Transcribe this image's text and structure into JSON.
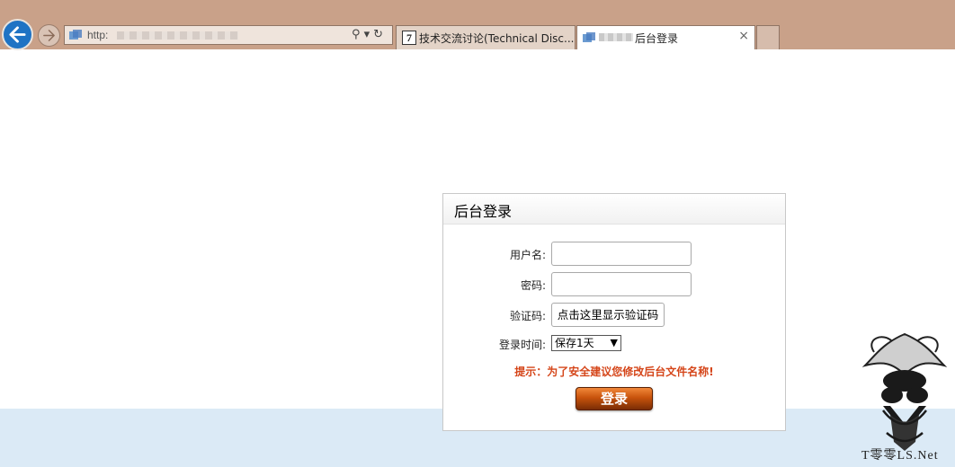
{
  "browser": {
    "address_text": "http:",
    "tabs": [
      {
        "label": "技术交流讨论(Technical Disc...",
        "active": false
      },
      {
        "label": "后台登录",
        "active": true
      }
    ],
    "close_glyph": "×"
  },
  "login": {
    "title": "后台登录",
    "username_label": "用户名:",
    "password_label": "密码:",
    "captcha_label": "验证码:",
    "captcha_button": "点击这里显示验证码",
    "time_label": "登录时间:",
    "time_selected": "保存1天",
    "hint": "提示：为了安全建议您修改后台文件名称!",
    "submit": "登录"
  },
  "watermark": {
    "text": "T零零LS.Net"
  },
  "colors": {
    "chrome": "#c9a189",
    "band": "#dbeaf6",
    "hint": "#d5461a",
    "button": "#c8530c"
  }
}
